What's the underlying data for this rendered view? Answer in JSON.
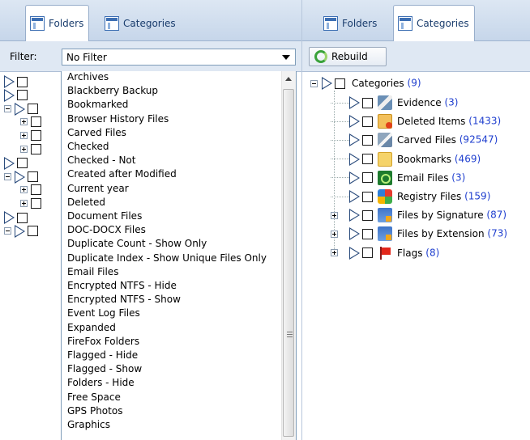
{
  "left_pane": {
    "tabs": [
      {
        "label": "Folders",
        "active": true
      },
      {
        "label": "Categories",
        "active": false
      }
    ],
    "filter": {
      "label": "Filter:",
      "selected": "No Filter"
    },
    "tree_rows": [
      {
        "label": "Archives",
        "expander": "none"
      },
      {
        "label": "Blackberry Backup",
        "expander": "none"
      },
      {
        "label": "Bookmarked",
        "expander": "minus"
      },
      {
        "label": "Browser History Files",
        "expander": "plus"
      },
      {
        "label": "Carved Files",
        "expander": "plus"
      },
      {
        "label": "Checked",
        "expander": "plus"
      },
      {
        "label": "Checked - Not",
        "expander": "none"
      },
      {
        "label": "Created after Modified",
        "expander": "minus"
      },
      {
        "label": "Current year",
        "expander": "plus"
      },
      {
        "label": "Deleted",
        "expander": "plus"
      },
      {
        "label": "Document Files",
        "expander": "none"
      },
      {
        "label": "DOC-DOCX Files",
        "expander": "minus"
      }
    ],
    "dropdown_options": [
      "Archives",
      "Blackberry Backup",
      "Bookmarked",
      "Browser History Files",
      "Carved Files",
      "Checked",
      "Checked - Not",
      "Created after Modified",
      "Current year",
      "Deleted",
      "Document Files",
      "DOC-DOCX Files",
      "Duplicate Count - Show Only",
      "Duplicate Index - Show Unique Files Only",
      "Email Files",
      "Encrypted NTFS - Hide",
      "Encrypted NTFS - Show",
      "Event Log Files",
      "Expanded",
      "FireFox Folders",
      "Flagged - Hide",
      "Flagged - Show",
      "Folders - Hide",
      "Free Space",
      "GPS Photos",
      "Graphics"
    ]
  },
  "right_pane": {
    "tabs": [
      {
        "label": "Folders",
        "active": false
      },
      {
        "label": "Categories",
        "active": true
      }
    ],
    "toolbar": {
      "rebuild_label": "Rebuild"
    },
    "root": {
      "label": "Categories",
      "count": "(9)"
    },
    "categories": [
      {
        "label": "Evidence",
        "count": "(3)",
        "icon": "evidence-icon",
        "expander": "none"
      },
      {
        "label": "Deleted Items",
        "count": "(1433)",
        "icon": "deleted-items-icon",
        "expander": "none"
      },
      {
        "label": "Carved Files",
        "count": "(92547)",
        "icon": "carved-files-icon",
        "expander": "none"
      },
      {
        "label": "Bookmarks",
        "count": "(469)",
        "icon": "bookmarks-icon",
        "expander": "none"
      },
      {
        "label": "Email Files",
        "count": "(3)",
        "icon": "email-files-icon",
        "expander": "none"
      },
      {
        "label": "Registry Files",
        "count": "(159)",
        "icon": "registry-files-icon",
        "expander": "none"
      },
      {
        "label": "Files by Signature",
        "count": "(87)",
        "icon": "files-by-signature-icon",
        "expander": "plus"
      },
      {
        "label": "Files by Extension",
        "count": "(73)",
        "icon": "files-by-extension-icon",
        "expander": "plus"
      },
      {
        "label": "Flags",
        "count": "(8)",
        "icon": "flags-icon",
        "expander": "plus"
      }
    ]
  }
}
